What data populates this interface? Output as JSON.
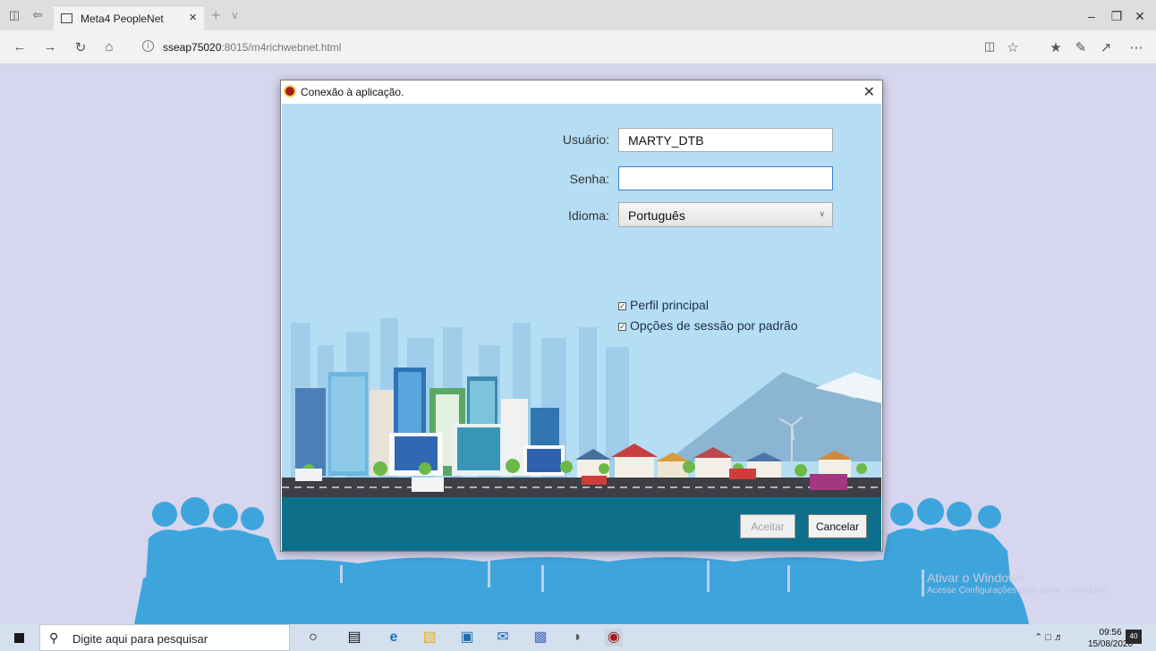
{
  "browser": {
    "tab_title": "Meta4 PeopleNet",
    "url_host": "sseap75020",
    "url_rest": ":8015/m4richwebnet.html"
  },
  "dialog": {
    "title": "Conexão à aplicação.",
    "user_label": "Usuário:",
    "user_value": "MARTY_DTB",
    "password_label": "Senha:",
    "password_value": "",
    "language_label": "Idioma:",
    "language_value": "Português",
    "check1_label": "Perfil principal",
    "check1_checked": true,
    "check2_label": "Opções de sessão por padrão",
    "check2_checked": true,
    "ok_label": "Aceitar",
    "cancel_label": "Cancelar"
  },
  "page": {
    "watermark_title": "Ativar o Windows",
    "watermark_sub": "Acesse Configurações para ativar o Windows."
  },
  "taskbar": {
    "search_placeholder": "Digite aqui para pesquisar",
    "time": "09:56",
    "date": "15/08/2020",
    "notif_count": "40"
  },
  "colors": {
    "dialog_sky": "#b5def4",
    "dialog_footer": "#0e6f8a",
    "crowd": "#3ea5dc",
    "page_bg": "#d7d6ef"
  }
}
